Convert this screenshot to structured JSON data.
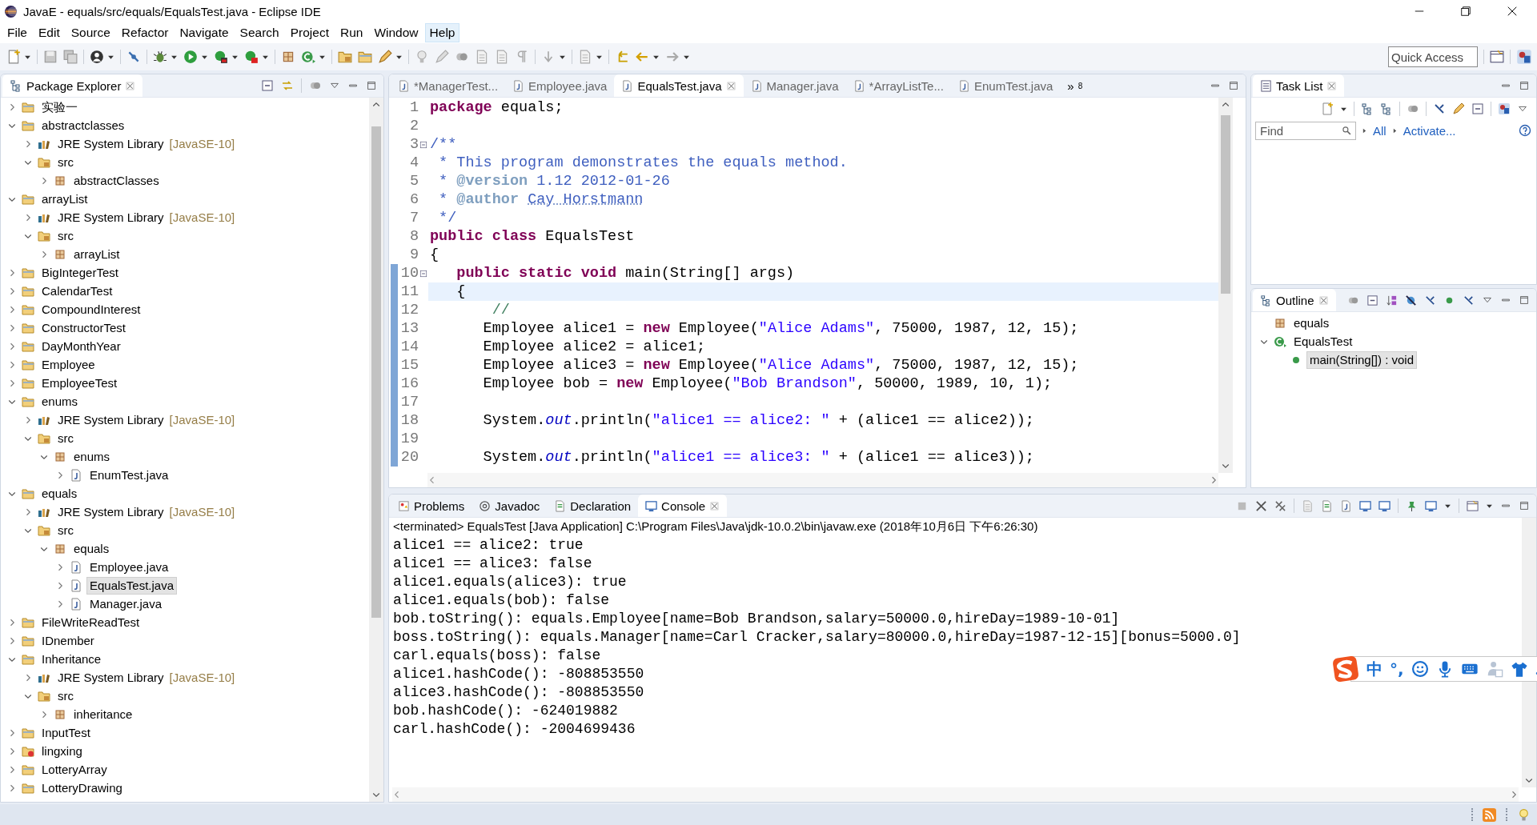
{
  "window": {
    "title": "JavaE - equals/src/equals/EqualsTest.java - Eclipse IDE"
  },
  "menu": [
    {
      "label": "File",
      "highlighted": false
    },
    {
      "label": "Edit",
      "highlighted": false
    },
    {
      "label": "Source",
      "highlighted": false
    },
    {
      "label": "Refactor",
      "highlighted": false
    },
    {
      "label": "Navigate",
      "highlighted": false
    },
    {
      "label": "Search",
      "highlighted": false
    },
    {
      "label": "Project",
      "highlighted": false
    },
    {
      "label": "Run",
      "highlighted": false
    },
    {
      "label": "Window",
      "highlighted": false
    },
    {
      "label": "Help",
      "highlighted": true
    }
  ],
  "toolbar": {
    "quick_access": {
      "placeholder": "Quick Access"
    }
  },
  "package_explorer": {
    "title": "Package Explorer",
    "items": [
      {
        "label": "实验一",
        "kind": "project",
        "expanded": false,
        "selected": false
      },
      {
        "label": "abstractclasses",
        "kind": "project",
        "expanded": true,
        "selected": false,
        "children": [
          {
            "label": "JRE System Library",
            "note": "[JavaSE-10]",
            "kind": "library",
            "expanded": false,
            "selected": false
          },
          {
            "label": "src",
            "kind": "source-folder",
            "expanded": true,
            "selected": false,
            "children": [
              {
                "label": "abstractClasses",
                "kind": "package",
                "expanded": false,
                "selected": false
              }
            ]
          }
        ]
      },
      {
        "label": "arrayList",
        "kind": "project",
        "expanded": true,
        "selected": false,
        "children": [
          {
            "label": "JRE System Library",
            "note": "[JavaSE-10]",
            "kind": "library",
            "expanded": false,
            "selected": false
          },
          {
            "label": "src",
            "kind": "source-folder",
            "expanded": true,
            "selected": false,
            "children": [
              {
                "label": "arrayList",
                "kind": "package",
                "expanded": false,
                "selected": false
              }
            ]
          }
        ]
      },
      {
        "label": "BigIntegerTest",
        "kind": "project",
        "expanded": false,
        "selected": false
      },
      {
        "label": "CalendarTest",
        "kind": "project",
        "expanded": false,
        "selected": false
      },
      {
        "label": "CompoundInterest",
        "kind": "project",
        "expanded": false,
        "selected": false
      },
      {
        "label": "ConstructorTest",
        "kind": "project",
        "expanded": false,
        "selected": false
      },
      {
        "label": "DayMonthYear",
        "kind": "project",
        "expanded": false,
        "selected": false
      },
      {
        "label": "Employee",
        "kind": "project",
        "expanded": false,
        "selected": false
      },
      {
        "label": "EmployeeTest",
        "kind": "project",
        "expanded": false,
        "selected": false
      },
      {
        "label": "enums",
        "kind": "project",
        "expanded": true,
        "selected": false,
        "children": [
          {
            "label": "JRE System Library",
            "note": "[JavaSE-10]",
            "kind": "library",
            "expanded": false,
            "selected": false
          },
          {
            "label": "src",
            "kind": "source-folder",
            "expanded": true,
            "selected": false,
            "children": [
              {
                "label": "enums",
                "kind": "package",
                "expanded": true,
                "selected": false,
                "children": [
                  {
                    "label": "EnumTest.java",
                    "kind": "java-file",
                    "expanded": false,
                    "selected": false
                  }
                ]
              }
            ]
          }
        ]
      },
      {
        "label": "equals",
        "kind": "project",
        "expanded": true,
        "selected": false,
        "children": [
          {
            "label": "JRE System Library",
            "note": "[JavaSE-10]",
            "kind": "library",
            "expanded": false,
            "selected": false
          },
          {
            "label": "src",
            "kind": "source-folder",
            "expanded": true,
            "selected": false,
            "children": [
              {
                "label": "equals",
                "kind": "package",
                "expanded": true,
                "selected": false,
                "children": [
                  {
                    "label": "Employee.java",
                    "kind": "java-file",
                    "expanded": false,
                    "selected": false
                  },
                  {
                    "label": "EqualsTest.java",
                    "kind": "java-file",
                    "expanded": false,
                    "selected": true
                  },
                  {
                    "label": "Manager.java",
                    "kind": "java-file",
                    "expanded": false,
                    "selected": false
                  }
                ]
              }
            ]
          }
        ]
      },
      {
        "label": "FileWriteReadTest",
        "kind": "project",
        "expanded": false,
        "selected": false
      },
      {
        "label": "IDnember",
        "kind": "project",
        "expanded": false,
        "selected": false
      },
      {
        "label": "Inheritance",
        "kind": "project",
        "expanded": true,
        "selected": false,
        "children": [
          {
            "label": "JRE System Library",
            "note": "[JavaSE-10]",
            "kind": "library",
            "expanded": false,
            "selected": false
          },
          {
            "label": "src",
            "kind": "source-folder",
            "expanded": true,
            "selected": false,
            "children": [
              {
                "label": "inheritance",
                "kind": "package",
                "expanded": false,
                "selected": false
              }
            ]
          }
        ]
      },
      {
        "label": "InputTest",
        "kind": "project",
        "expanded": false,
        "selected": false
      },
      {
        "label": "lingxing",
        "kind": "project-error",
        "expanded": false,
        "selected": false
      },
      {
        "label": "LotteryArray",
        "kind": "project",
        "expanded": false,
        "selected": false
      },
      {
        "label": "LotteryDrawing",
        "kind": "project",
        "expanded": false,
        "selected": false
      }
    ]
  },
  "editor": {
    "tabs": [
      {
        "label": "*ManagerTest...",
        "selected": false
      },
      {
        "label": "Employee.java",
        "selected": false
      },
      {
        "label": "EqualsTest.java",
        "selected": true
      },
      {
        "label": "Manager.java",
        "selected": false
      },
      {
        "label": "*ArrayListTe...",
        "selected": false
      },
      {
        "label": "EnumTest.java",
        "selected": false
      }
    ],
    "overflow": {
      "symbol": "»",
      "count": "8"
    },
    "lines": [
      {
        "number": "1",
        "fold": false,
        "current": false,
        "in_range": false,
        "tokens": [
          {
            "kind": "keyword",
            "text": "package"
          },
          {
            "kind": "plain",
            "text": " equals;"
          }
        ]
      },
      {
        "number": "2",
        "fold": false,
        "current": false,
        "in_range": false
      },
      {
        "number": "3",
        "fold": true,
        "current": false,
        "in_range": false,
        "tokens": [
          {
            "kind": "doc",
            "text": "/**"
          }
        ]
      },
      {
        "number": "4",
        "fold": false,
        "current": false,
        "in_range": false,
        "tokens": [
          {
            "kind": "doc",
            "text": " * This program demonstrates the equals method."
          }
        ]
      },
      {
        "number": "5",
        "fold": false,
        "current": false,
        "in_range": false,
        "tokens": [
          {
            "kind": "doc",
            "text": " * "
          },
          {
            "kind": "tag",
            "text": "@version"
          },
          {
            "kind": "doc",
            "text": " 1.12 2012-01-26"
          }
        ]
      },
      {
        "number": "6",
        "fold": false,
        "current": false,
        "in_range": false,
        "tokens": [
          {
            "kind": "doc",
            "text": " * "
          },
          {
            "kind": "tag",
            "text": "@author "
          },
          {
            "kind": "spelling",
            "text": "Cay Horstmann"
          }
        ]
      },
      {
        "number": "7",
        "fold": false,
        "current": false,
        "in_range": false,
        "tokens": [
          {
            "kind": "doc",
            "text": " */"
          }
        ]
      },
      {
        "number": "8",
        "fold": false,
        "current": false,
        "in_range": false,
        "tokens": [
          {
            "kind": "keyword",
            "text": "public class"
          },
          {
            "kind": "plain",
            "text": " EqualsTest"
          }
        ]
      },
      {
        "number": "9",
        "fold": false,
        "current": false,
        "in_range": false,
        "tokens": [
          {
            "kind": "plain",
            "text": "{"
          }
        ]
      },
      {
        "number": "10",
        "fold": true,
        "current": false,
        "in_range": true,
        "tokens": [
          {
            "kind": "keyword",
            "text": "   public static void"
          },
          {
            "kind": "plain",
            "text": " main(String[] args)"
          }
        ]
      },
      {
        "number": "11",
        "fold": false,
        "current": true,
        "in_range": true,
        "tokens": [
          {
            "kind": "plain",
            "text": "   {"
          }
        ]
      },
      {
        "number": "12",
        "fold": false,
        "current": false,
        "in_range": true,
        "tokens": [
          {
            "kind": "comment",
            "text": "       //"
          }
        ]
      },
      {
        "number": "13",
        "fold": false,
        "current": false,
        "in_range": true,
        "tokens": [
          {
            "kind": "plain",
            "text": "      Employee alice1 = "
          },
          {
            "kind": "keyword",
            "text": "new"
          },
          {
            "kind": "plain",
            "text": " Employee("
          },
          {
            "kind": "string",
            "text": "\"Alice Adams\""
          },
          {
            "kind": "plain",
            "text": ", 75000, 1987, 12, 15);"
          }
        ]
      },
      {
        "number": "14",
        "fold": false,
        "current": false,
        "in_range": true,
        "tokens": [
          {
            "kind": "plain",
            "text": "      Employee alice2 = alice1;"
          }
        ]
      },
      {
        "number": "15",
        "fold": false,
        "current": false,
        "in_range": true,
        "tokens": [
          {
            "kind": "plain",
            "text": "      Employee alice3 = "
          },
          {
            "kind": "keyword",
            "text": "new"
          },
          {
            "kind": "plain",
            "text": " Employee("
          },
          {
            "kind": "string",
            "text": "\"Alice Adams\""
          },
          {
            "kind": "plain",
            "text": ", 75000, 1987, 12, 15);"
          }
        ]
      },
      {
        "number": "16",
        "fold": false,
        "current": false,
        "in_range": true,
        "tokens": [
          {
            "kind": "plain",
            "text": "      Employee bob = "
          },
          {
            "kind": "keyword",
            "text": "new"
          },
          {
            "kind": "plain",
            "text": " Employee("
          },
          {
            "kind": "string",
            "text": "\"Bob Brandson\""
          },
          {
            "kind": "plain",
            "text": ", 50000, 1989, 10, 1);"
          }
        ]
      },
      {
        "number": "17",
        "fold": false,
        "current": false,
        "in_range": true
      },
      {
        "number": "18",
        "fold": false,
        "current": false,
        "in_range": true,
        "tokens": [
          {
            "kind": "plain",
            "text": "      System."
          },
          {
            "kind": "field",
            "text": "out"
          },
          {
            "kind": "plain",
            "text": ".println("
          },
          {
            "kind": "string",
            "text": "\"alice1 == alice2: \""
          },
          {
            "kind": "plain",
            "text": " + (alice1 == alice2));"
          }
        ]
      },
      {
        "number": "19",
        "fold": false,
        "current": false,
        "in_range": true
      },
      {
        "number": "20",
        "fold": false,
        "current": false,
        "in_range": true,
        "tokens": [
          {
            "kind": "plain",
            "text": "      System."
          },
          {
            "kind": "field",
            "text": "out"
          },
          {
            "kind": "plain",
            "text": ".println("
          },
          {
            "kind": "string",
            "text": "\"alice1 == alice3: \""
          },
          {
            "kind": "plain",
            "text": " + (alice1 == alice3));"
          }
        ]
      }
    ]
  },
  "task_list": {
    "title": "Task List",
    "find": {
      "placeholder": "Find"
    },
    "links": [
      "All",
      "Activate..."
    ]
  },
  "outline": {
    "title": "Outline",
    "items": [
      {
        "label": "equals",
        "kind": "package",
        "selected": false
      },
      {
        "label": "EqualsTest",
        "kind": "class",
        "expanded": true,
        "selected": false,
        "children": [
          {
            "label": "main(String[]) : void",
            "kind": "method",
            "selected": true
          }
        ]
      }
    ]
  },
  "console": {
    "tabs": [
      {
        "label": "Problems",
        "kind": "problems",
        "selected": false
      },
      {
        "label": "Javadoc",
        "kind": "javadoc",
        "selected": false
      },
      {
        "label": "Declaration",
        "kind": "declaration",
        "selected": false
      },
      {
        "label": "Console",
        "kind": "console",
        "selected": true
      }
    ],
    "header": "<terminated> EqualsTest [Java Application] C:\\Program Files\\Java\\jdk-10.0.2\\bin\\javaw.exe (2018年10月6日 下午6:26:30)",
    "lines": [
      "alice1 == alice2: true",
      "alice1 == alice3: false",
      "alice1.equals(alice3): true",
      "alice1.equals(bob): false",
      "bob.toString(): equals.Employee[name=Bob Brandson,salary=50000.0,hireDay=1989-10-01]",
      "boss.toString(): equals.Manager[name=Carl Cracker,salary=80000.0,hireDay=1987-12-15][bonus=5000.0]",
      "carl.equals(boss): false",
      "alice1.hashCode(): -808853550",
      "alice3.hashCode(): -808853550",
      "bob.hashCode(): -624019882",
      "carl.hashCode(): -2004699436"
    ]
  },
  "ime_toolbar": {
    "mode": "中",
    "punctuation": "°,"
  }
}
